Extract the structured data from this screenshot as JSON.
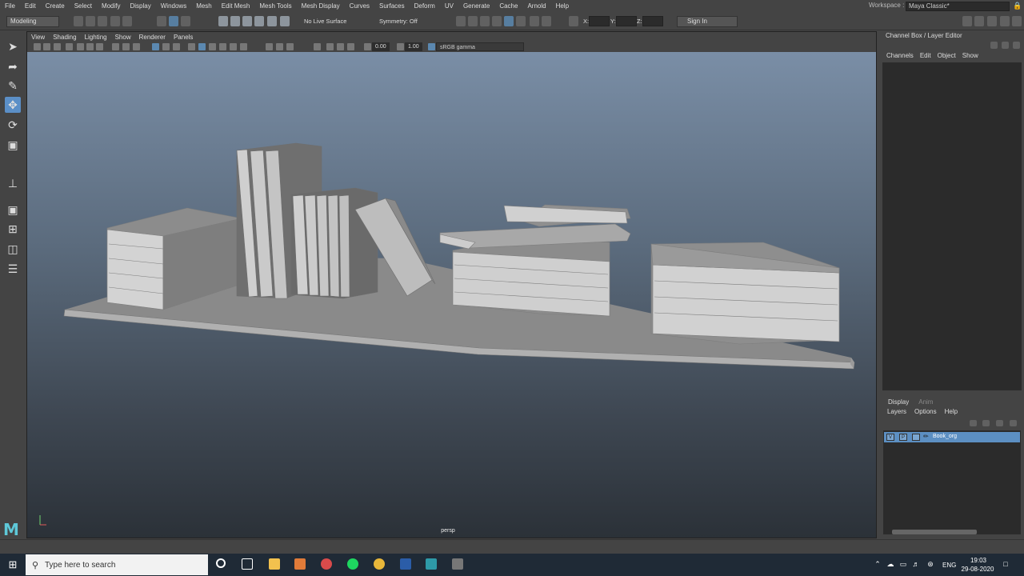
{
  "menubar": {
    "items": [
      "File",
      "Edit",
      "Create",
      "Select",
      "Modify",
      "Display",
      "Windows",
      "Mesh",
      "Edit Mesh",
      "Mesh Tools",
      "Mesh Display",
      "Curves",
      "Surfaces",
      "Deform",
      "UV",
      "Generate",
      "Cache",
      "Arnold",
      "Help"
    ],
    "workspace_label": "Workspace :",
    "workspace_value": "Maya Classic*"
  },
  "statusline": {
    "mode": "Modeling",
    "live_surface": "No Live Surface",
    "symmetry": "Symmetry: Off",
    "coord_x": "X:",
    "coord_y": "Y:",
    "coord_z": "Z:",
    "sign_in": "Sign In"
  },
  "panel": {
    "menu": [
      "View",
      "Shading",
      "Lighting",
      "Show",
      "Renderer",
      "Panels"
    ],
    "exposure": "0.00",
    "gamma": "1.00",
    "colorspace": "sRGB gamma",
    "camera": "persp"
  },
  "channelbox": {
    "title": "Channel Box / Layer Editor",
    "menu": [
      "Channels",
      "Edit",
      "Object",
      "Show"
    ]
  },
  "layer_editor": {
    "tabs": [
      "Display",
      "Anim"
    ],
    "menu": [
      "Layers",
      "Options",
      "Help"
    ],
    "layer": {
      "visible": "V",
      "playback": "P",
      "name": "Book_org"
    }
  },
  "taskbar": {
    "search_placeholder": "Type here to search",
    "language": "ENG",
    "time": "19:03",
    "date": "29-08-2020"
  },
  "colors": {
    "accent": "#5b8fc7",
    "viewport_top": "#7a8ea6",
    "viewport_bottom": "#2b3138",
    "maya_logo": "#5ec8d8"
  }
}
